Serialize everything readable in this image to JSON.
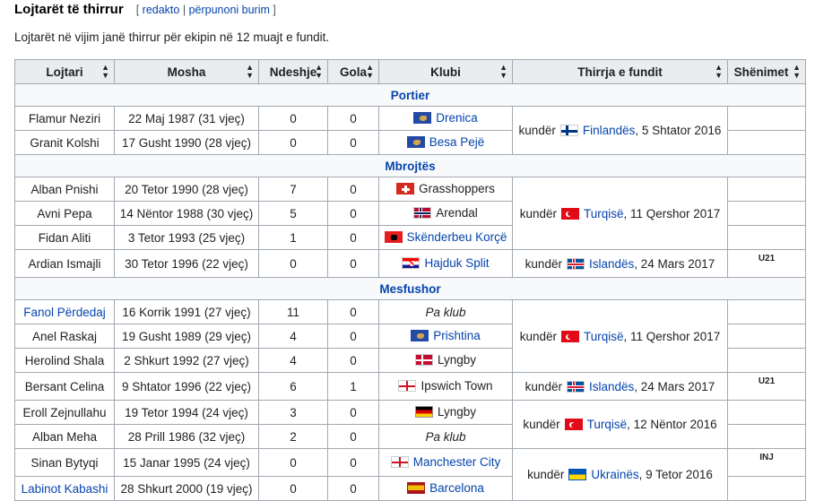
{
  "section": {
    "title": "Lojtarët të thirrur",
    "edit_open": "[",
    "edit_link": "redakto",
    "edit_sep": "|",
    "edit_source": "përpunoni burim",
    "edit_close": "]",
    "intro": "Lojtarët në vijim janë thirrur për ekipin në 12 muajt e fundit."
  },
  "table": {
    "headers": [
      "Lojtari",
      "Mosha",
      "Ndeshje",
      "Gola",
      "Klubi",
      "Thirrja e fundit",
      "Shënimet"
    ],
    "categories": {
      "gk": "Portier",
      "df": "Mbrojtës",
      "mf": "Mesfushor"
    },
    "callups": {
      "c1": {
        "pre": "kundër",
        "team": "Finlandës",
        "date": ", 5 Shtator 2016",
        "flag": "finland-flag"
      },
      "c2": {
        "pre": "kundër",
        "team": "Turqisë",
        "date": ", 11 Qershor 2017",
        "flag": "turkey-flag"
      },
      "c3": {
        "pre": "kundër",
        "team": "Islandës",
        "date": ", 24 Mars 2017",
        "flag": "iceland-flag"
      },
      "c4": {
        "pre": "kundër",
        "team": "Turqisë",
        "date": ", 11 Qershor 2017",
        "flag": "turkey-flag"
      },
      "c5": {
        "pre": "kundër",
        "team": "Islandës",
        "date": ", 24 Mars 2017",
        "flag": "iceland-flag"
      },
      "c6": {
        "pre": "kundër",
        "team": "Turqisë",
        "date": ", 12 Nëntor 2016",
        "flag": "turkey-flag"
      },
      "c7": {
        "pre": "kundër",
        "team": "Ukrainës",
        "date": ", 9 Tetor 2016",
        "flag": "ukraine-flag"
      }
    },
    "notes": {
      "u21a": "U21",
      "u21b": "U21",
      "inj": "INJ"
    },
    "players": [
      {
        "name": "Flamur Neziri",
        "age": "22 Maj 1987 (31 vjeç)",
        "caps": "0",
        "goals": "0",
        "club": "Drenica",
        "club_flag": "kosovo-flag"
      },
      {
        "name": "Granit Kolshi",
        "age": "17 Gusht 1990 (28 vjeç)",
        "caps": "0",
        "goals": "0",
        "club": "Besa Pejë",
        "club_flag": "kosovo-flag"
      },
      {
        "name": "Alban Pnishi",
        "age": "20 Tetor 1990 (28 vjeç)",
        "caps": "7",
        "goals": "0",
        "club": "Grasshoppers",
        "club_flag": "switzerland-flag"
      },
      {
        "name": "Avni Pepa",
        "age": "14 Nëntor 1988 (30 vjeç)",
        "caps": "5",
        "goals": "0",
        "club": "Arendal",
        "club_flag": "norway-flag"
      },
      {
        "name": "Fidan Aliti",
        "age": "3 Tetor 1993 (25 vjeç)",
        "caps": "1",
        "goals": "0",
        "club": "Skënderbeu Korçë",
        "club_flag": "albania-flag"
      },
      {
        "name": "Ardian Ismajli",
        "age": "30 Tetor 1996 (22 vjeç)",
        "caps": "0",
        "goals": "0",
        "club": "Hajduk Split",
        "club_flag": "croatia-flag"
      },
      {
        "name": "Fanol Përdedaj",
        "age": "16 Korrik 1991 (27 vjeç)",
        "caps": "11",
        "goals": "0",
        "club": "Pa klub",
        "club_flag": ""
      },
      {
        "name": "Anel Raskaj",
        "age": "19 Gusht 1989 (29 vjeç)",
        "caps": "4",
        "goals": "0",
        "club": "Prishtina",
        "club_flag": "kosovo-flag"
      },
      {
        "name": "Herolind Shala",
        "age": "2 Shkurt 1992 (27 vjeç)",
        "caps": "4",
        "goals": "0",
        "club": "Lyngby",
        "club_flag": "denmark-flag"
      },
      {
        "name": "Bersant Celina",
        "age": "9 Shtator 1996 (22 vjeç)",
        "caps": "6",
        "goals": "1",
        "club": "Ipswich Town",
        "club_flag": "england-flag"
      },
      {
        "name": "Eroll Zejnullahu",
        "age": "19 Tetor 1994 (24 vjeç)",
        "caps": "3",
        "goals": "0",
        "club": "Lyngby",
        "club_flag": "germany-flag"
      },
      {
        "name": "Alban Meha",
        "age": "28 Prill 1986 (32 vjeç)",
        "caps": "2",
        "goals": "0",
        "club": "Pa klub",
        "club_flag": ""
      },
      {
        "name": "Sinan Bytyqi",
        "age": "15 Janar 1995 (24 vjeç)",
        "caps": "0",
        "goals": "0",
        "club": "Manchester City",
        "club_flag": "england-flag"
      },
      {
        "name": "Labinot Kabashi",
        "age": "28 Shkurt 2000 (19 vjeç)",
        "caps": "0",
        "goals": "0",
        "club": "Barcelona",
        "club_flag": "spain-flag"
      }
    ],
    "colors": {
      "link": "#0645ad",
      "redlink": "#ba0000",
      "header_bg": "#eaecf0",
      "border": "#a2a9b1"
    }
  }
}
